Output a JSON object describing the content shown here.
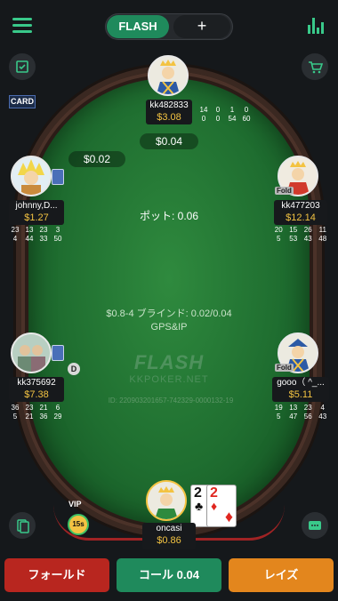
{
  "tabs": {
    "flash": "FLASH",
    "plus": "+"
  },
  "card_chip": "CARD",
  "table": {
    "pot": "ポット: 0.06",
    "blinds": "$0.8-4 ブラインド: 0.02/0.04",
    "mode": "GPS&IP",
    "logo_main": "FLASH",
    "logo_sub": "KKPOKER.NET",
    "table_id": "ID: 220903201657-742329-0000132-19"
  },
  "bets": {
    "top": "$0.04",
    "left": "$0.02"
  },
  "players": {
    "top": {
      "name": "kk482833",
      "stack": "$3.08",
      "stats": [
        "14",
        "0",
        "1",
        "0",
        "0",
        "0",
        "54",
        "60"
      ]
    },
    "left_upper": {
      "name": "johnny,D...",
      "stack": "$1.27",
      "stats": [
        "23",
        "13",
        "23",
        "3",
        "4",
        "44",
        "33",
        "50"
      ]
    },
    "right_upper": {
      "name": "kk477203",
      "stack": "$12.14",
      "fold": "Fold",
      "stats": [
        "20",
        "15",
        "26",
        "11",
        "5",
        "53",
        "43",
        "48"
      ]
    },
    "left_lower": {
      "name": "kk375692",
      "stack": "$7.38",
      "stats": [
        "36",
        "23",
        "21",
        "6",
        "5",
        "21",
        "36",
        "29"
      ]
    },
    "right_lower": {
      "name": "gooo（ ^_...",
      "stack": "$5.11",
      "fold": "Fold",
      "stats": [
        "19",
        "13",
        "23",
        "4",
        "5",
        "47",
        "56",
        "43"
      ]
    },
    "hero": {
      "name": "oncasi",
      "stack": "$0.86"
    }
  },
  "dealer_button": "D",
  "hero_cards": [
    {
      "rank": "2",
      "suit": "♣",
      "color": "#111111"
    },
    {
      "rank": "2",
      "suit": "♦",
      "color": "#e0261f"
    }
  ],
  "vip": "VIP",
  "timer": "15s",
  "actions": {
    "fold": "フォールド",
    "call": "コール 0.04",
    "raise": "レイズ"
  },
  "colors": {
    "accent": "#1f8a5c",
    "stack": "#f3c342",
    "fold": "#b8261f",
    "raise": "#e3861d"
  },
  "icons": [
    "menu-icon",
    "stats-icon",
    "calendar-check-icon",
    "cart-icon",
    "cards-icon",
    "chat-icon",
    "clock-icon",
    "vip-icon"
  ]
}
